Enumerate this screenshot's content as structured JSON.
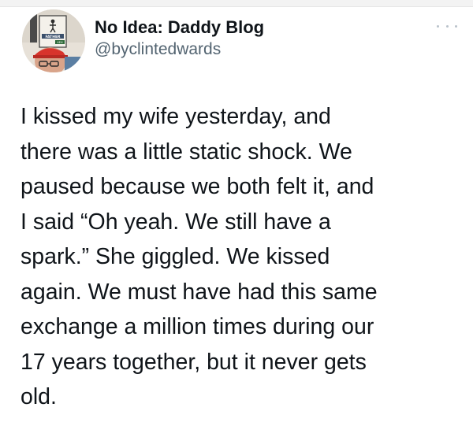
{
  "tweet": {
    "author": {
      "display_name": "No Idea: Daddy Blog",
      "handle": "@byclintedwards",
      "avatar_sign_text": "FATHER",
      "avatar_sign_subtext": "4EH"
    },
    "more_icon": "more-horizontal-icon",
    "text_lines": [
      "I kissed my wife yesterday, and",
      "there was a little static shock. We",
      "paused because we both felt it, and",
      "I said “Oh yeah. We still have a",
      "spark.” She giggled. We kissed",
      "again. We must have had this same",
      "exchange a million times during our",
      "17 years together, but it never gets",
      "old."
    ]
  },
  "colors": {
    "text": "#0f1419",
    "secondary_text": "#536471",
    "background": "#ffffff",
    "more_dots": "#b9c2ca"
  }
}
